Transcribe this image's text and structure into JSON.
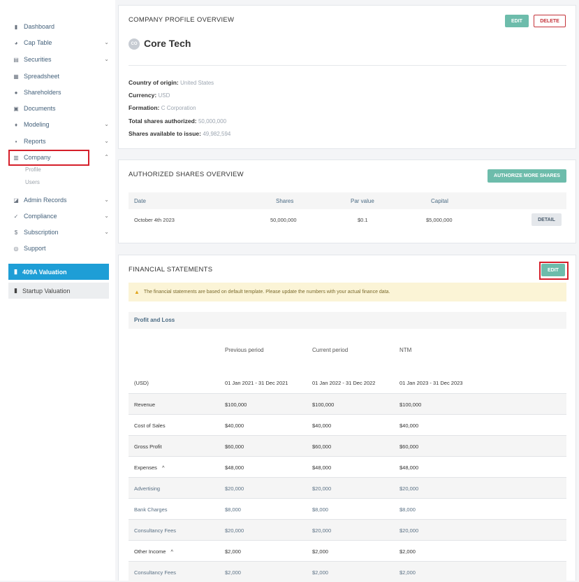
{
  "sidebar": {
    "items": [
      {
        "label": "Dashboard",
        "icon": "dashboard-icon",
        "chevron": ""
      },
      {
        "label": "Cap Table",
        "icon": "pie-chart-icon",
        "chevron": "⌄"
      },
      {
        "label": "Securities",
        "icon": "clipboard-icon",
        "chevron": "⌄"
      },
      {
        "label": "Spreadsheet",
        "icon": "spreadsheet-icon",
        "chevron": ""
      },
      {
        "label": "Shareholders",
        "icon": "person-icon",
        "chevron": ""
      },
      {
        "label": "Documents",
        "icon": "document-icon",
        "chevron": ""
      },
      {
        "label": "Modeling",
        "icon": "bulb-icon",
        "chevron": "⌄"
      },
      {
        "label": "Reports",
        "icon": "report-icon",
        "chevron": "⌄"
      },
      {
        "label": "Company",
        "icon": "building-icon",
        "chevron": "⌃"
      },
      {
        "label": "Admin Records",
        "icon": "records-icon",
        "chevron": "⌄"
      },
      {
        "label": "Compliance",
        "icon": "check-circle-icon",
        "chevron": "⌄"
      },
      {
        "label": "Subscription",
        "icon": "dollar-icon",
        "chevron": "⌄"
      },
      {
        "label": "Support",
        "icon": "support-icon",
        "chevron": ""
      }
    ],
    "company_sub": [
      "Profile",
      "Users"
    ],
    "valuation_409a": "409A Valuation",
    "startup_valuation": "Startup Valuation"
  },
  "profile": {
    "title": "COMPANY PROFILE OVERVIEW",
    "edit": "EDIT",
    "delete": "DELETE",
    "avatar": "CO",
    "company_name": "Core Tech",
    "fields": [
      {
        "label": "Country of origin:",
        "value": "United States"
      },
      {
        "label": "Currency:",
        "value": "USD"
      },
      {
        "label": "Formation:",
        "value": "C Corporation"
      },
      {
        "label": "Total shares authorized:",
        "value": "50,000,000"
      },
      {
        "label": "Shares available to issue:",
        "value": "49,982,594"
      }
    ]
  },
  "authorized": {
    "title": "AUTHORIZED SHARES OVERVIEW",
    "button": "AUTHORIZE MORE SHARES",
    "headers": {
      "date": "Date",
      "shares": "Shares",
      "par": "Par value",
      "capital": "Capital"
    },
    "row": {
      "date": "October 4th 2023",
      "shares": "50,000,000",
      "par": "$0.1",
      "capital": "$5,000,000",
      "detail": "DETAIL"
    }
  },
  "financial": {
    "title": "FINANCIAL STATEMENTS",
    "edit": "EDIT",
    "warning": "The financial statements are based on default template. Please update the numbers with your actual finance data.",
    "section": "Profit and Loss",
    "periods": [
      "Previous period",
      "Current period",
      "NTM"
    ],
    "unit": "(USD)",
    "ranges": [
      "01 Jan 2021 - 31 Dec 2021",
      "01 Jan 2022 - 31 Dec 2022",
      "01 Jan 2023 - 31 Dec 2023"
    ],
    "rows": [
      {
        "label": "Revenue",
        "v": [
          "$100,000",
          "$100,000",
          "$100,000"
        ]
      },
      {
        "label": "Cost of Sales",
        "v": [
          "$40,000",
          "$40,000",
          "$40,000"
        ]
      },
      {
        "label": "Gross Profit",
        "v": [
          "$60,000",
          "$60,000",
          "$60,000"
        ]
      },
      {
        "label": "Expenses",
        "caret": "^",
        "v": [
          "$48,000",
          "$48,000",
          "$48,000"
        ]
      },
      {
        "label": "Advertising",
        "sub": true,
        "v": [
          "$20,000",
          "$20,000",
          "$20,000"
        ]
      },
      {
        "label": "Bank Charges",
        "sub": true,
        "v": [
          "$8,000",
          "$8,000",
          "$8,000"
        ]
      },
      {
        "label": "Consultancy Fees",
        "sub": true,
        "v": [
          "$20,000",
          "$20,000",
          "$20,000"
        ]
      },
      {
        "label": "Other Income",
        "caret": "^",
        "v": [
          "$2,000",
          "$2,000",
          "$2,000"
        ]
      },
      {
        "label": "Consultancy Fees",
        "sub": true,
        "v": [
          "$2,000",
          "$2,000",
          "$2,000"
        ]
      }
    ]
  }
}
